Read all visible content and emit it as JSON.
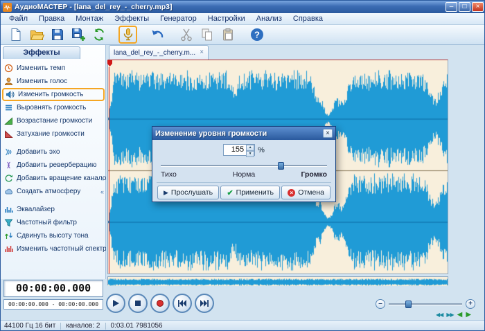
{
  "colors": {
    "accent_highlight": "#f5a623",
    "waveform": "#209bd6",
    "waveform_background": "#f8efdc",
    "record_red": "#d83030",
    "titlebar_blue": "#3c6cb4"
  },
  "window": {
    "title": "АудиоМАСТЕР - [lana_del_rey_-_cherry.mp3]",
    "minimize": "–",
    "maximize": "□",
    "close": "×"
  },
  "menu": {
    "items": [
      "Файл",
      "Правка",
      "Монтаж",
      "Эффекты",
      "Генератор",
      "Настройки",
      "Анализ",
      "Справка"
    ]
  },
  "toolbar": {
    "buttons": [
      {
        "name": "new",
        "icon": "new-file-icon"
      },
      {
        "name": "open",
        "icon": "open-folder-icon"
      },
      {
        "name": "save",
        "icon": "save-icon"
      },
      {
        "name": "save-as",
        "icon": "save-as-icon"
      },
      {
        "name": "convert",
        "icon": "convert-icon"
      },
      {
        "name": "record",
        "icon": "microphone-icon",
        "highlighted": true
      },
      {
        "name": "undo",
        "icon": "undo-icon"
      },
      {
        "name": "cut",
        "icon": "scissors-icon",
        "disabled": true
      },
      {
        "name": "copy",
        "icon": "copy-icon",
        "disabled": true
      },
      {
        "name": "paste",
        "icon": "paste-icon",
        "disabled": true
      },
      {
        "name": "help",
        "icon": "help-icon"
      }
    ]
  },
  "sidebar": {
    "header": "Эффекты",
    "items": [
      {
        "label": "Изменить темп",
        "icon": "clock-icon"
      },
      {
        "label": "Изменить голос",
        "icon": "voice-icon"
      },
      {
        "label": "Изменить громкость",
        "icon": "speaker-icon",
        "highlighted": true
      },
      {
        "label": "Выровнять громкость",
        "icon": "level-bars-icon"
      },
      {
        "label": "Возрастание громкости",
        "icon": "ramp-up-icon"
      },
      {
        "label": "Затухание громкости",
        "icon": "ramp-down-icon"
      },
      {
        "label": "Добавить эхо",
        "icon": "echo-icon"
      },
      {
        "label": "Добавить реверберацию",
        "icon": "reverb-icon"
      },
      {
        "label": "Добавить вращение каналов",
        "icon": "rotate-icon",
        "expand": "«"
      },
      {
        "label": "Создать атмосферу",
        "icon": "atmosphere-icon",
        "expand": "«"
      },
      {
        "label": "Эквалайзер",
        "icon": "equalizer-icon"
      },
      {
        "label": "Частотный фильтр",
        "icon": "filter-icon"
      },
      {
        "label": "Сдвинуть высоту тона",
        "icon": "pitch-icon"
      },
      {
        "label": "Изменить частотный спектр",
        "icon": "spectrum-icon"
      }
    ]
  },
  "tabs": {
    "active_label": "lana_del_rey_-_cherry.m...",
    "close": "×"
  },
  "dialog": {
    "title": "Изменение уровня громкости",
    "close": "×",
    "value": "155",
    "unit": "%",
    "spinner": {
      "up": "▲",
      "down": "▼"
    },
    "slider": {
      "quiet": "Тихо",
      "normal": "Норма",
      "loud": "Громко",
      "position_percent": 72
    },
    "buttons": {
      "listen": "Прослушать",
      "apply": "Применить",
      "cancel": "Отмена"
    },
    "button_icons": {
      "listen": "▶",
      "apply": "✔",
      "cancel": "×"
    }
  },
  "transport": {
    "buttons": [
      {
        "name": "play",
        "icon": "play-icon"
      },
      {
        "name": "stop",
        "icon": "stop-icon"
      },
      {
        "name": "record",
        "icon": "record-icon"
      },
      {
        "name": "previous",
        "icon": "skip-back-icon"
      },
      {
        "name": "next",
        "icon": "skip-forward-icon"
      }
    ]
  },
  "time": {
    "current": "00:00:00.000",
    "selection": "00:00:00.000 - 00:00:00.000"
  },
  "zoom": {
    "minus": "–",
    "plus": "+",
    "position_percent": 26
  },
  "nav": {
    "scroll_left": "◀◀",
    "scroll_right": "▶▶",
    "jump_start": "◀",
    "jump_end": "▶"
  },
  "status": {
    "format": "44100 Гц 16 бит",
    "channels": "каналов: 2",
    "position": "0:03.01 7981056"
  }
}
